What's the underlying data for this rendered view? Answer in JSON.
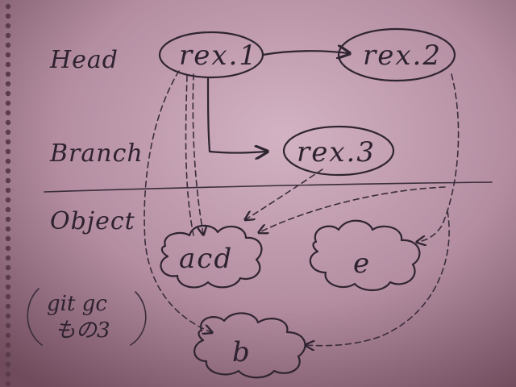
{
  "diagram": {
    "row_labels": {
      "head": "Head",
      "branch": "Branch",
      "object": "Object"
    },
    "nodes": {
      "rev1": "rex.1",
      "rev2": "rex.2",
      "rev3": "rex.3",
      "acd": "acd",
      "e": "e",
      "b": "b"
    },
    "note": {
      "line1": "git gc",
      "line2": "もの3"
    }
  },
  "colors": {
    "paper_top": "#c9a7b8",
    "paper_bottom": "#7e5667",
    "ink": "#2f2431"
  }
}
